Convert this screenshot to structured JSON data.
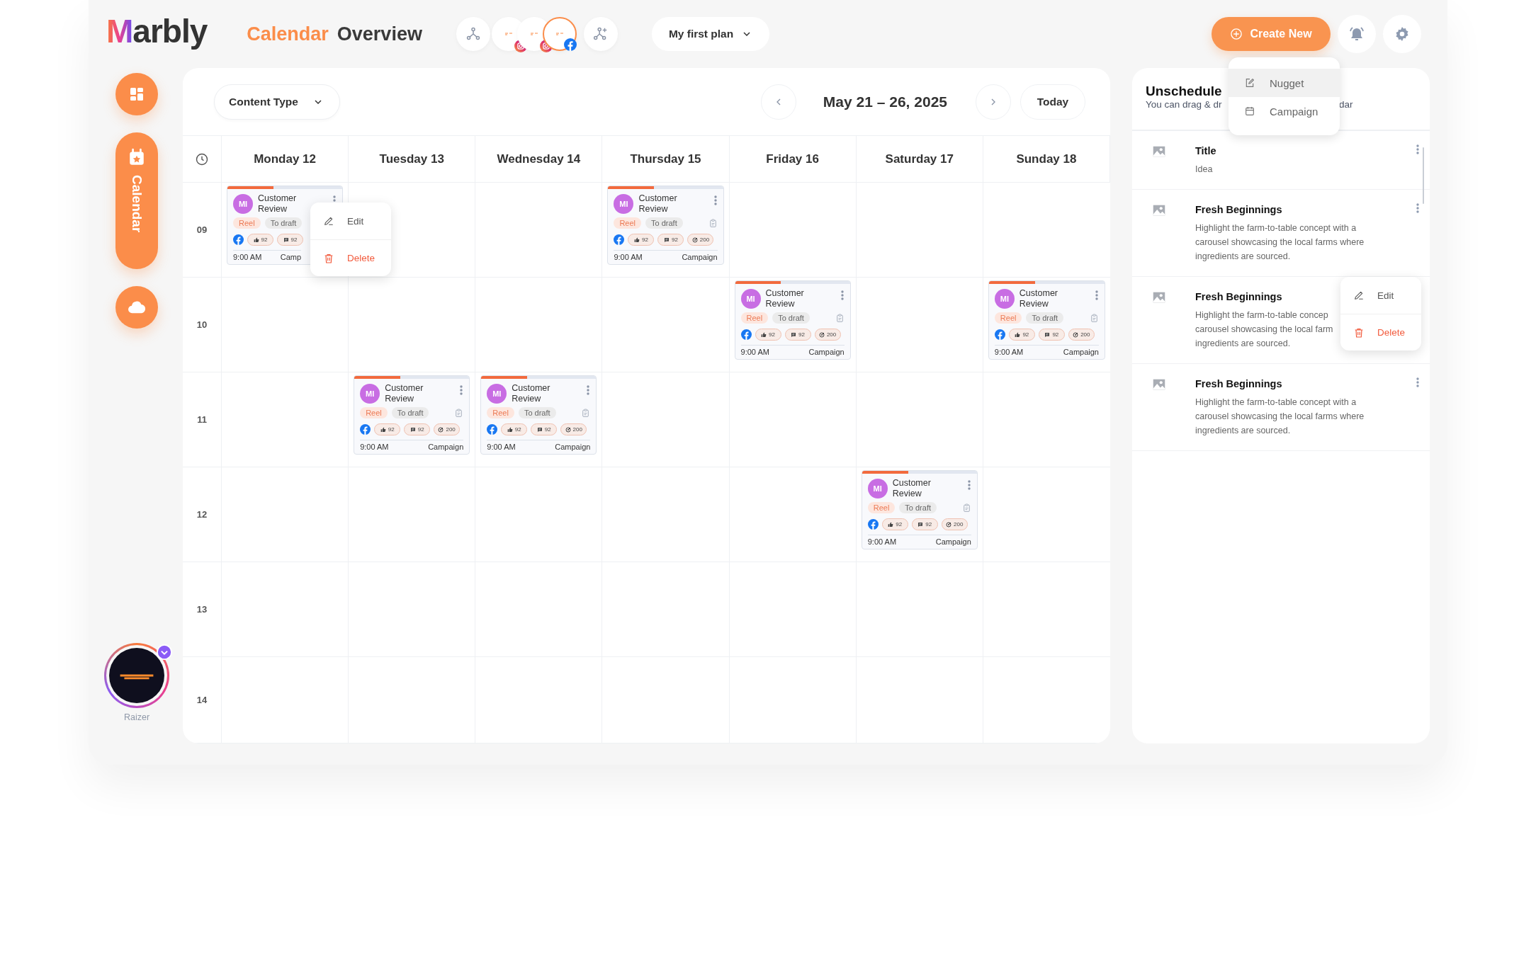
{
  "logo": "Marbly",
  "title": {
    "accent": "Calendar",
    "rest": "Overview"
  },
  "accounts": [
    {
      "kind": "network"
    },
    {
      "kind": "instagram",
      "selected": false
    },
    {
      "kind": "instagram",
      "selected": false
    },
    {
      "kind": "facebook",
      "selected": true
    },
    {
      "kind": "add"
    }
  ],
  "plan": "My first plan",
  "create": {
    "label": "Create New",
    "menu": [
      {
        "kind": "nugget",
        "label": "Nugget",
        "selected": true
      },
      {
        "kind": "campaign",
        "label": "Campaign",
        "selected": false
      }
    ]
  },
  "sidebar": {
    "items": [
      {
        "kind": "dashboard",
        "selected": false
      },
      {
        "kind": "calendar",
        "label": "Calendar",
        "selected": true
      },
      {
        "kind": "cloud",
        "selected": false
      }
    ],
    "profile": "Raizer"
  },
  "calendar": {
    "filter": "Content Type",
    "range": "May 21 – 26, 2025",
    "today": "Today",
    "days": [
      "Monday 12",
      "Tuesday 13",
      "Wednesday 14",
      "Thursday 15",
      "Friday 16",
      "Saturday 17",
      "Sunday 18"
    ],
    "hours": [
      {
        "label": "09",
        "cells": [
          {
            "event": {
              "avatar": "MI",
              "title": "Customer Review",
              "level": 0.4,
              "tags": [
                {
                  "kind": "format",
                  "label": "Reel"
                },
                {
                  "kind": "status",
                  "label": "To draft"
                }
              ],
              "stats": [
                {
                  "kind": "likes",
                  "value": "92"
                },
                {
                  "kind": "comments",
                  "value": "92"
                }
              ],
              "time": "9:00 AM",
              "label": "Camp",
              "menu": [
                {
                  "kind": "edit",
                  "label": "Edit"
                },
                {
                  "kind": "delete",
                  "label": "Delete"
                }
              ]
            }
          },
          {},
          {},
          {
            "event": {
              "avatar": "MI",
              "title": "Customer Review",
              "level": 0.4,
              "tags": [
                {
                  "kind": "format",
                  "label": "Reel"
                },
                {
                  "kind": "status",
                  "label": "To draft"
                }
              ],
              "stats": [
                {
                  "kind": "likes",
                  "value": "92"
                },
                {
                  "kind": "comments",
                  "value": "92"
                },
                {
                  "kind": "reach",
                  "value": "200"
                }
              ],
              "time": "9:00 AM",
              "label": "Campaign"
            }
          },
          {},
          {},
          {}
        ]
      },
      {
        "label": "10",
        "cells": [
          {},
          {},
          {},
          {},
          {
            "event": {
              "avatar": "MI",
              "title": "Customer Review",
              "level": 0.4,
              "tags": [
                {
                  "kind": "format",
                  "label": "Reel"
                },
                {
                  "kind": "status",
                  "label": "To draft"
                }
              ],
              "stats": [
                {
                  "kind": "likes",
                  "value": "92"
                },
                {
                  "kind": "comments",
                  "value": "92"
                },
                {
                  "kind": "reach",
                  "value": "200"
                }
              ],
              "time": "9:00 AM",
              "label": "Campaign"
            }
          },
          {},
          {
            "event": {
              "avatar": "MI",
              "title": "Customer Review",
              "level": 0.4,
              "tags": [
                {
                  "kind": "format",
                  "label": "Reel"
                },
                {
                  "kind": "status",
                  "label": "To draft"
                }
              ],
              "stats": [
                {
                  "kind": "likes",
                  "value": "92"
                },
                {
                  "kind": "comments",
                  "value": "92"
                },
                {
                  "kind": "reach",
                  "value": "200"
                }
              ],
              "time": "9:00 AM",
              "label": "Campaign"
            }
          }
        ]
      },
      {
        "label": "11",
        "cells": [
          {},
          {
            "event": {
              "avatar": "MI",
              "title": "Customer Review",
              "level": 0.4,
              "tags": [
                {
                  "kind": "format",
                  "label": "Reel"
                },
                {
                  "kind": "status",
                  "label": "To draft"
                }
              ],
              "stats": [
                {
                  "kind": "likes",
                  "value": "92"
                },
                {
                  "kind": "comments",
                  "value": "92"
                },
                {
                  "kind": "reach",
                  "value": "200"
                }
              ],
              "time": "9:00 AM",
              "label": "Campaign"
            }
          },
          {
            "event": {
              "avatar": "MI",
              "title": "Customer Review",
              "level": 0.4,
              "tags": [
                {
                  "kind": "format",
                  "label": "Reel"
                },
                {
                  "kind": "status",
                  "label": "To draft"
                }
              ],
              "stats": [
                {
                  "kind": "likes",
                  "value": "92"
                },
                {
                  "kind": "comments",
                  "value": "92"
                },
                {
                  "kind": "reach",
                  "value": "200"
                }
              ],
              "time": "9:00 AM",
              "label": "Campaign"
            }
          },
          {},
          {},
          {},
          {}
        ]
      },
      {
        "label": "12",
        "cells": [
          {},
          {},
          {},
          {},
          {},
          {
            "event": {
              "avatar": "MI",
              "title": "Customer Review",
              "level": 0.4,
              "tags": [
                {
                  "kind": "format",
                  "label": "Reel"
                },
                {
                  "kind": "status",
                  "label": "To draft"
                }
              ],
              "stats": [
                {
                  "kind": "likes",
                  "value": "92"
                },
                {
                  "kind": "comments",
                  "value": "92"
                },
                {
                  "kind": "reach",
                  "value": "200"
                }
              ],
              "time": "9:00 AM",
              "label": "Campaign"
            }
          },
          {}
        ]
      },
      {
        "label": "13",
        "cells": [
          {},
          {},
          {},
          {},
          {},
          {},
          {}
        ]
      },
      {
        "label": "14",
        "cells": [
          {},
          {},
          {},
          {},
          {},
          {},
          {}
        ]
      }
    ]
  },
  "unscheduled": {
    "title": "Unschedule",
    "subtitle_start": "You can drag & dr",
    "subtitle_end": "dar",
    "items": [
      {
        "title": "Title",
        "lines": [
          "Idea"
        ]
      },
      {
        "title": "Fresh Beginnings",
        "lines": [
          "Highlight the farm-to-table concept with a",
          "carousel showcasing the local farms where",
          "ingredients are sourced."
        ]
      },
      {
        "title": "Fresh Beginnings",
        "lines": [
          "Highlight the farm-to-table concep",
          "carousel showcasing the local farm",
          "ingredients are sourced."
        ],
        "menu": [
          {
            "kind": "edit",
            "label": "Edit"
          },
          {
            "kind": "delete",
            "label": "Delete"
          }
        ]
      },
      {
        "title": "Fresh Beginnings",
        "lines": [
          "Highlight the farm-to-table concept with a",
          "carousel showcasing the local farms where",
          "ingredients are sourced."
        ]
      }
    ]
  }
}
